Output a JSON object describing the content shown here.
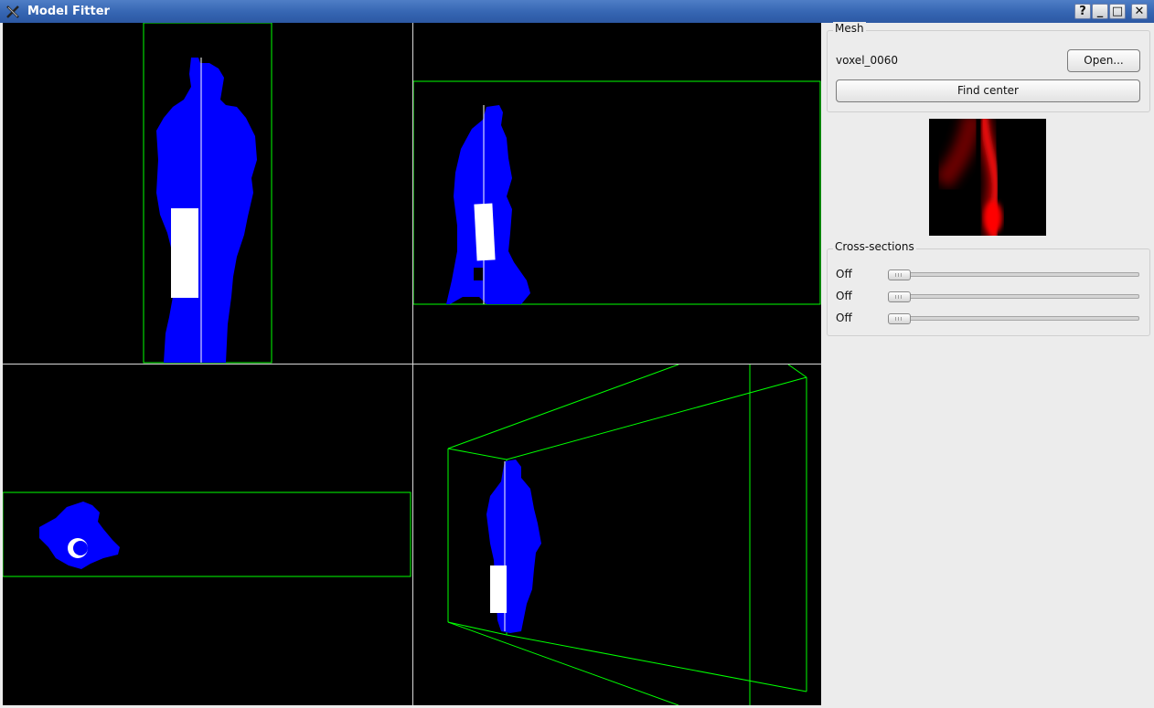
{
  "window": {
    "title": "Model Fitter",
    "buttons": [
      "?",
      "_",
      "□",
      "✕"
    ]
  },
  "viewports": {
    "front": "front-view",
    "side": "side-view",
    "top": "top-view",
    "perspective": "perspective-view",
    "colors": {
      "mesh": "#0000ff",
      "box": "#00ff00",
      "axis": "#ffffff",
      "cylinder": "#ffffff"
    }
  },
  "mesh": {
    "group_title": "Mesh",
    "name": "voxel_0060",
    "open_label": "Open...",
    "find_center_label": "Find center"
  },
  "cross_sections": {
    "group_title": "Cross-sections",
    "sliders": [
      {
        "label": "Off",
        "value": 0
      },
      {
        "label": "Off",
        "value": 0
      },
      {
        "label": "Off",
        "value": 0
      }
    ]
  }
}
